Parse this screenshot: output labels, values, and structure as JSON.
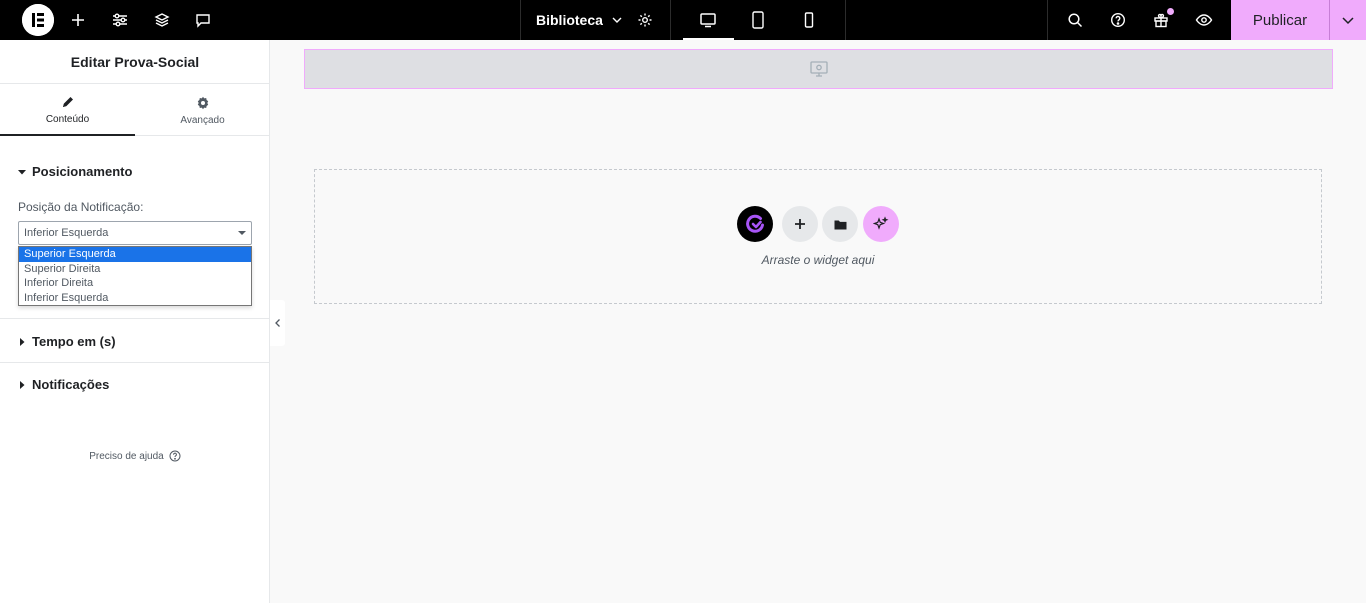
{
  "topbar": {
    "library_label": "Biblioteca",
    "publish_label": "Publicar",
    "icons": [
      "elementor-logo-icon",
      "add-icon",
      "settings-sliders-icon",
      "layers-icon",
      "comments-icon",
      "chevron-down-icon",
      "gear-icon",
      "desktop-icon",
      "tablet-icon",
      "mobile-icon",
      "search-icon",
      "help-icon",
      "gift-icon",
      "eye-icon"
    ]
  },
  "panel": {
    "title": "Editar Prova-Social",
    "tabs": [
      {
        "label": "Conteúdo",
        "icon": "pencil-icon",
        "active": true
      },
      {
        "label": "Avançado",
        "icon": "gear-icon",
        "active": false
      }
    ],
    "sections": {
      "positioning": "Posicionamento",
      "time": "Tempo em (s)",
      "notifications": "Notificações"
    },
    "position_field": {
      "label": "Posição da Notificação:",
      "value": "Inferior Esquerda",
      "options": [
        "Superior Esquerda",
        "Superior Direita",
        "Inferior Direita",
        "Inferior Esquerda"
      ],
      "highlighted": "Superior Esquerda"
    },
    "help_label": "Preciso de ajuda"
  },
  "canvas": {
    "drop_hint": "Arraste o widget aqui"
  },
  "colors": {
    "accent": "#f0abfc",
    "topbar": "#000000",
    "highlight": "#1a73e8"
  }
}
